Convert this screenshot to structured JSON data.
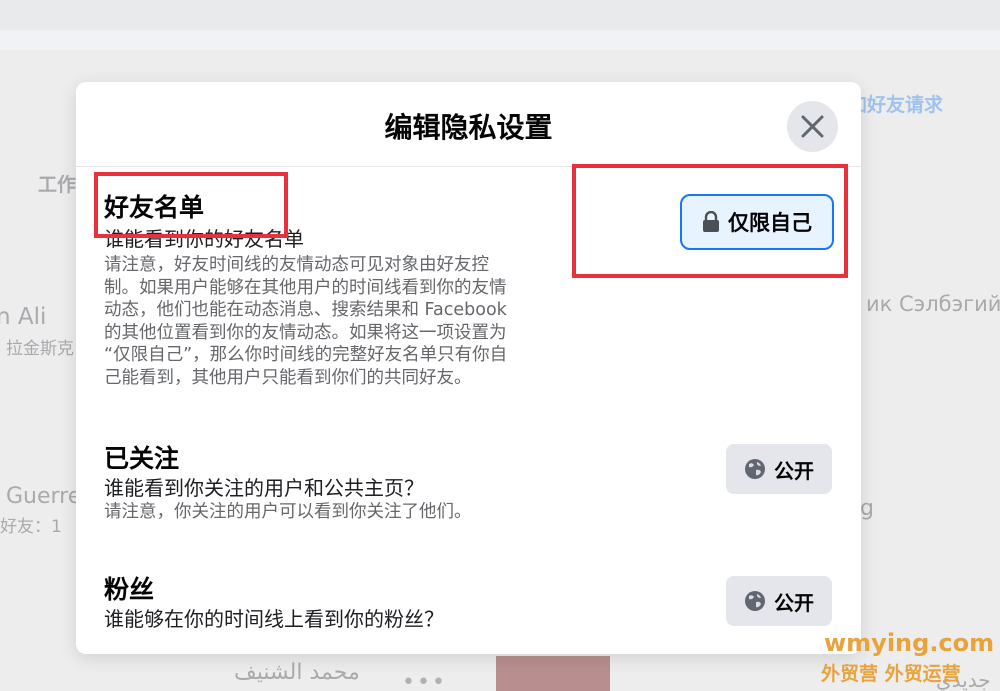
{
  "background": {
    "friend_requests_link": "加好友请求",
    "work_tab": "工作",
    "name_left_1": "n Ali",
    "location_left_1": "拉金斯克",
    "name_right_1": "ик Сэлбэгийн",
    "name_left_2": "Guerre",
    "friends_left_2": "好友：1",
    "text_right_2": "g",
    "name_bottom": "محمد الشنيف",
    "text_bottom_right": "جديدي"
  },
  "modal": {
    "title": "编辑隐私设置",
    "sections": [
      {
        "title": "好友名单",
        "question": "谁能看到你的好友名单",
        "note": [
          "请注意，好友时间线的友情动态可见对象由好友控",
          "制。如果用户能够在其他用户的时间线看到你的友情",
          "动态，他们也能在动态消息、搜索结果和 Facebook",
          "的其他位置看到你的友情动态。如果将这一项设置为",
          "“仅限自己”，那么你时间线的完整好友名单只有你自",
          "己能看到，其他用户只能看到你们的共同好友。"
        ],
        "audience": "仅限自己",
        "audience_icon": "lock-icon"
      },
      {
        "title": "已关注",
        "question": "谁能看到你关注的用户和公共主页？",
        "note": [
          "请注意，你关注的用户可以看到你关注了他们。"
        ],
        "audience": "公开",
        "audience_icon": "globe-icon"
      },
      {
        "title": "粉丝",
        "question": "谁能够在你的时间线上看到你的粉丝？",
        "audience": "公开",
        "audience_icon": "globe-icon"
      }
    ]
  },
  "watermark": {
    "domain": "wmying.com",
    "tagline": "外贸营 外贸运营"
  },
  "colors": {
    "accent": "#1877f2",
    "highlight": "#e8313b",
    "watermark": "#e8a33d"
  }
}
